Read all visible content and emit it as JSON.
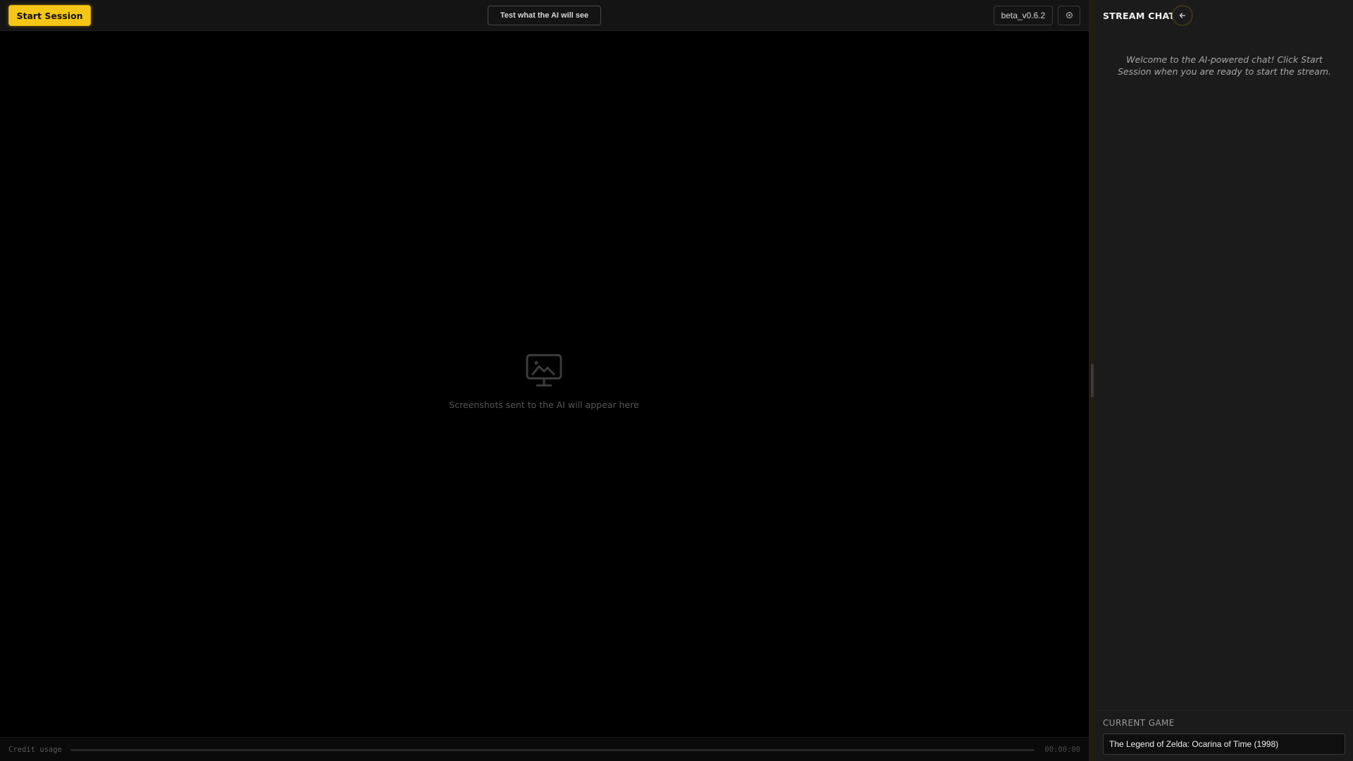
{
  "toolbar": {
    "start_session_label": "Start Session",
    "test_ai_label": "Test what the AI will see",
    "version": "beta_v0.6.2",
    "settings_icon": "gear-icon"
  },
  "viewer": {
    "empty_icon": "monitor-image-icon",
    "empty_text": "Screenshots sent to the AI will appear here"
  },
  "credit": {
    "label": "Credit usage",
    "usage_fraction": 0,
    "timer": "00:00:00"
  },
  "chat": {
    "title": "STREAM CHAT",
    "collapse_icon": "arrow-left-icon",
    "welcome": "Welcome to the AI-powered chat! Click Start Session when you are ready to start the stream."
  },
  "current_game": {
    "label": "CURRENT GAME",
    "value": "The Legend of Zelda: Ocarina of Time (1998)"
  },
  "colors": {
    "accent": "#f5c518",
    "background": "#000000",
    "panel": "#1b1b1b"
  }
}
